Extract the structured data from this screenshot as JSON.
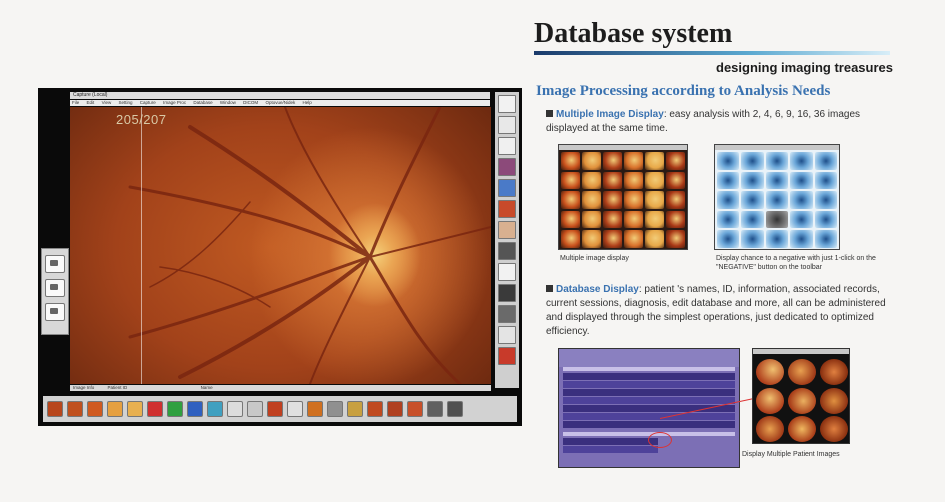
{
  "header": {
    "title": "Database system",
    "tagline": "designing imaging treasures"
  },
  "section": {
    "title": "Image Processing according to Analysis Needs"
  },
  "multiple_display": {
    "keyword": "Multiple Image Display",
    "text": ": easy analysis with 2, 4, 6, 9, 16, 36 images displayed at the same time.",
    "caption_left": "Multiple image display",
    "caption_right": "Display chance to a negative with just 1-click on the \"NEGATIVE\" button on the toolbar"
  },
  "database_display": {
    "keyword": "Database Display",
    "text": ": patient 's names, ID, information, associated records, current sessions, diagnosis, edit database and more, all can be administered and displayed through the simplest operations, just dedicated to optimized efficiency.",
    "caption": "Display Multiple Patient Images"
  },
  "app": {
    "title": "Capture (Local)",
    "menu": [
      "File",
      "Edit",
      "View",
      "Setting",
      "Capture",
      "Image Proc",
      "Database",
      "Window",
      "DICOM",
      "Optovue/Nidek",
      "Help"
    ],
    "counter": "205/207",
    "status_left": "Image Info",
    "status_patient": "Patient ID",
    "status_name": "Name"
  },
  "colors": {
    "accent_blue": "#3a72b0",
    "fundus_red": "#b04a1e",
    "db_purple": "#7c6fb5"
  }
}
